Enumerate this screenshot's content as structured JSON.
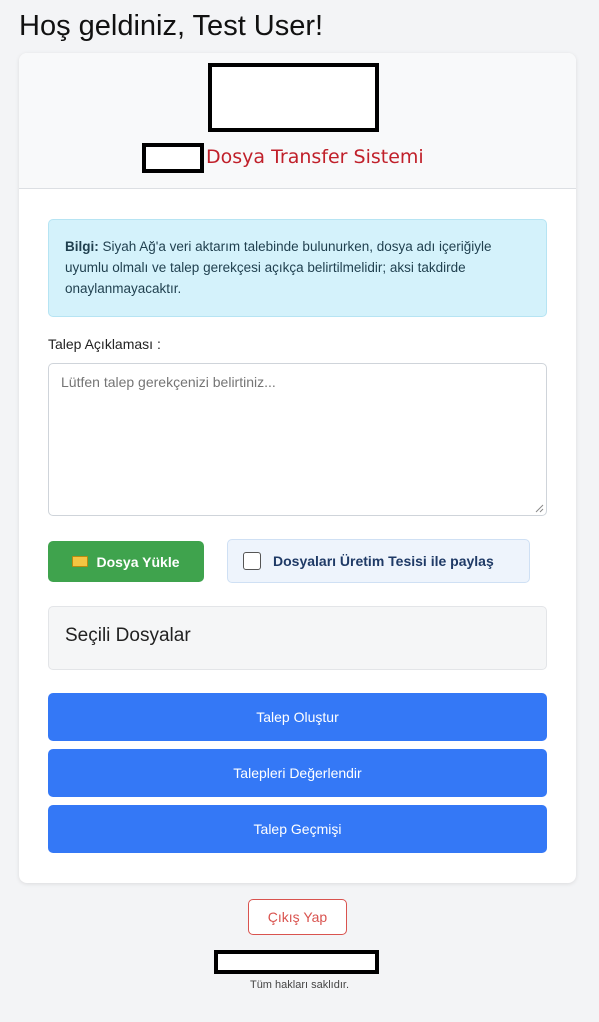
{
  "header": {
    "welcome": "Hoş geldiniz, Test User!"
  },
  "card": {
    "system_title": "Dosya Transfer Sistemi",
    "info": {
      "label": "Bilgi:",
      "text": " Siyah Ağ'a veri aktarım talebinde bulunurken, dosya adı içeriğiyle uyumlu olmalı ve talep gerekçesi açıkça belirtilmelidir; aksi takdirde onaylanmayacaktır."
    },
    "request_label": "Talep Açıklaması :",
    "request_placeholder": "Lütfen talep gerekçenizi belirtiniz...",
    "upload_button": "Dosya Yükle",
    "share_checkbox_label": "Dosyaları Üretim Tesisi ile paylaş",
    "share_checked": false,
    "selected_files_title": "Seçili Dosyalar",
    "actions": [
      {
        "label": "Talep Oluştur"
      },
      {
        "label": "Talepleri Değerlendir"
      },
      {
        "label": "Talep Geçmişi"
      }
    ]
  },
  "footer": {
    "logout": "Çıkış Yap",
    "copyright": "Tüm hakları saklıdır."
  },
  "colors": {
    "primary": "#3478f6",
    "success": "#3fa34d",
    "danger": "#d9534f",
    "title_red": "#c0202a",
    "info_bg": "#d4f2fb"
  }
}
